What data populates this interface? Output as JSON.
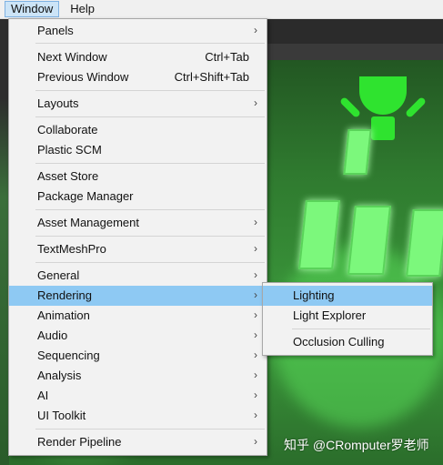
{
  "menubar": {
    "items": [
      {
        "label": "Window",
        "active": true
      },
      {
        "label": "Help",
        "active": false
      }
    ]
  },
  "window_menu": {
    "items": [
      {
        "label": "Panels",
        "shortcut": "",
        "submenu": true
      },
      {
        "label": "Next Window",
        "shortcut": "Ctrl+Tab",
        "submenu": false
      },
      {
        "label": "Previous Window",
        "shortcut": "Ctrl+Shift+Tab",
        "submenu": false
      },
      {
        "label": "Layouts",
        "shortcut": "",
        "submenu": true
      },
      {
        "label": "Collaborate",
        "shortcut": "",
        "submenu": false
      },
      {
        "label": "Plastic SCM",
        "shortcut": "",
        "submenu": false
      },
      {
        "label": "Asset Store",
        "shortcut": "",
        "submenu": false
      },
      {
        "label": "Package Manager",
        "shortcut": "",
        "submenu": false
      },
      {
        "label": "Asset Management",
        "shortcut": "",
        "submenu": true
      },
      {
        "label": "TextMeshPro",
        "shortcut": "",
        "submenu": true
      },
      {
        "label": "General",
        "shortcut": "",
        "submenu": true
      },
      {
        "label": "Rendering",
        "shortcut": "",
        "submenu": true
      },
      {
        "label": "Animation",
        "shortcut": "",
        "submenu": true
      },
      {
        "label": "Audio",
        "shortcut": "",
        "submenu": true
      },
      {
        "label": "Sequencing",
        "shortcut": "",
        "submenu": true
      },
      {
        "label": "Analysis",
        "shortcut": "",
        "submenu": true
      },
      {
        "label": "AI",
        "shortcut": "",
        "submenu": true
      },
      {
        "label": "UI Toolkit",
        "shortcut": "",
        "submenu": true
      },
      {
        "label": "Render Pipeline",
        "shortcut": "",
        "submenu": true
      }
    ],
    "highlighted": "Rendering"
  },
  "rendering_submenu": {
    "items": [
      {
        "label": "Lighting"
      },
      {
        "label": "Light Explorer"
      },
      {
        "label": "Occlusion Culling"
      }
    ],
    "highlighted": "Lighting"
  },
  "watermark": "知乎 @CRomputer罗老师",
  "colors": {
    "menu_bg": "#f2f2f2",
    "highlight": "#8ec9f3",
    "menubar_active": "#cce4f7",
    "scene_green": "#3c9a3c",
    "scene_light": "#7cf87c"
  },
  "icons": {
    "submenu_arrow": "chevron-right-icon"
  }
}
